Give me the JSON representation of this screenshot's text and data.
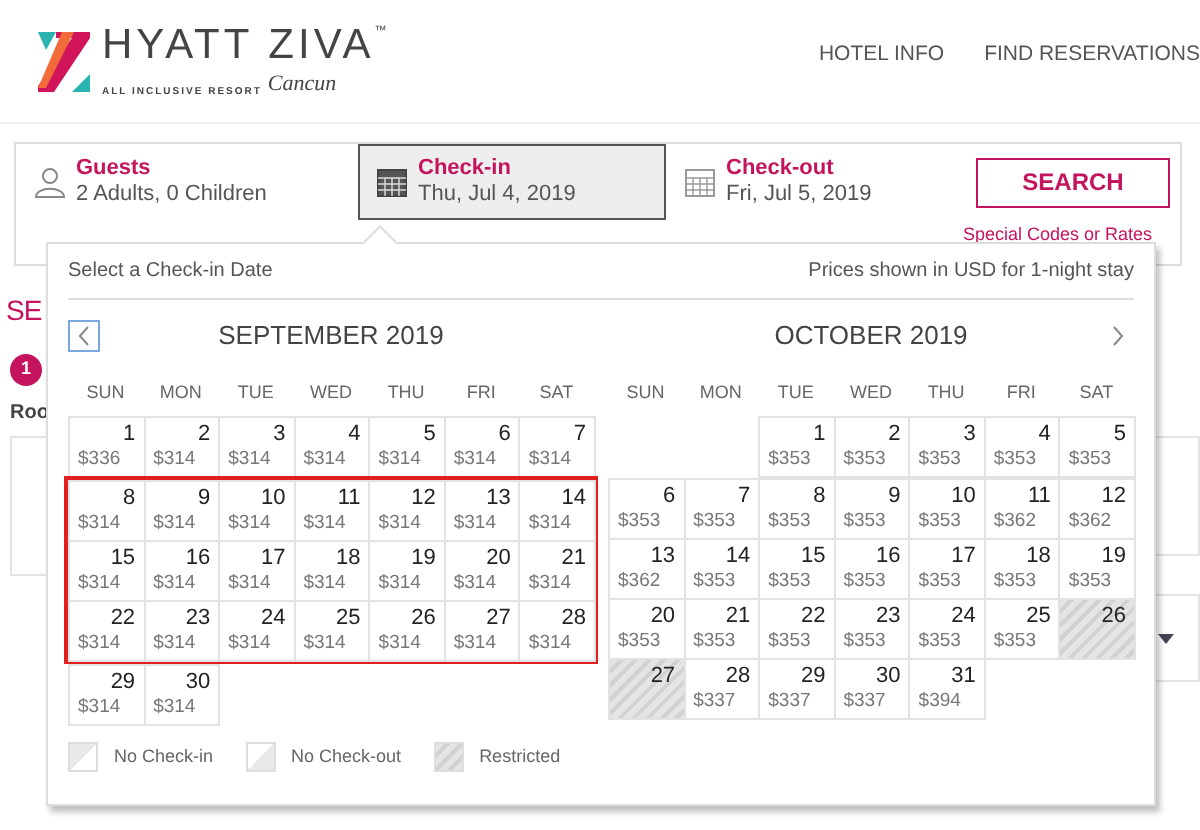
{
  "logo": {
    "name": "HYATT ZIVA",
    "trademark": "™",
    "tagline": "ALL INCLUSIVE RESORT",
    "location": "Cancun"
  },
  "nav": [
    "HOTEL INFO",
    "FIND RESERVATIONS"
  ],
  "search_bar": {
    "fields": [
      {
        "kind": "guests",
        "label": "Guests",
        "value": "2 Adults, 0 Children",
        "selected": false
      },
      {
        "kind": "calendar",
        "label": "Check-in",
        "value": "Thu, Jul 4, 2019",
        "selected": true
      },
      {
        "kind": "calendar",
        "label": "Check-out",
        "value": "Fri, Jul 5, 2019",
        "selected": false
      }
    ],
    "button": "SEARCH",
    "link": "Special Codes or Rates"
  },
  "background": {
    "heading": "SE",
    "step": "1",
    "subheading": "Roo"
  },
  "date_picker": {
    "title": "Select a Check-in Date",
    "note": "Prices shown in USD for 1-night stay",
    "months": [
      {
        "title": "SEPTEMBER 2019",
        "prev_arrow": true,
        "next_arrow": false,
        "weekdays": [
          "SUN",
          "MON",
          "TUE",
          "WED",
          "THU",
          "FRI",
          "SAT"
        ],
        "weeks": [
          {
            "highlighted": false,
            "days": [
              {
                "day": "1",
                "price": "$336",
                "kind": "open"
              },
              {
                "day": "2",
                "price": "$314",
                "kind": "open"
              },
              {
                "day": "3",
                "price": "$314",
                "kind": "open"
              },
              {
                "day": "4",
                "price": "$314",
                "kind": "open"
              },
              {
                "day": "5",
                "price": "$314",
                "kind": "open"
              },
              {
                "day": "6",
                "price": "$314",
                "kind": "open"
              },
              {
                "day": "7",
                "price": "$314",
                "kind": "open"
              }
            ]
          },
          {
            "highlighted": true,
            "days": [
              {
                "day": "8",
                "price": "$314",
                "kind": "open"
              },
              {
                "day": "9",
                "price": "$314",
                "kind": "open"
              },
              {
                "day": "10",
                "price": "$314",
                "kind": "open"
              },
              {
                "day": "11",
                "price": "$314",
                "kind": "open"
              },
              {
                "day": "12",
                "price": "$314",
                "kind": "open"
              },
              {
                "day": "13",
                "price": "$314",
                "kind": "open"
              },
              {
                "day": "14",
                "price": "$314",
                "kind": "open"
              }
            ]
          },
          {
            "highlighted": true,
            "days": [
              {
                "day": "15",
                "price": "$314",
                "kind": "open"
              },
              {
                "day": "16",
                "price": "$314",
                "kind": "open"
              },
              {
                "day": "17",
                "price": "$314",
                "kind": "open"
              },
              {
                "day": "18",
                "price": "$314",
                "kind": "open"
              },
              {
                "day": "19",
                "price": "$314",
                "kind": "open"
              },
              {
                "day": "20",
                "price": "$314",
                "kind": "open"
              },
              {
                "day": "21",
                "price": "$314",
                "kind": "open"
              }
            ]
          },
          {
            "highlighted": true,
            "days": [
              {
                "day": "22",
                "price": "$314",
                "kind": "open"
              },
              {
                "day": "23",
                "price": "$314",
                "kind": "open"
              },
              {
                "day": "24",
                "price": "$314",
                "kind": "open"
              },
              {
                "day": "25",
                "price": "$314",
                "kind": "open"
              },
              {
                "day": "26",
                "price": "$314",
                "kind": "open"
              },
              {
                "day": "27",
                "price": "$314",
                "kind": "open"
              },
              {
                "day": "28",
                "price": "$314",
                "kind": "open"
              }
            ]
          },
          {
            "highlighted": false,
            "days": [
              {
                "day": "29",
                "price": "$314",
                "kind": "open"
              },
              {
                "day": "30",
                "price": "$314",
                "kind": "open"
              },
              {
                "kind": "empty"
              },
              {
                "kind": "empty"
              },
              {
                "kind": "empty"
              },
              {
                "kind": "empty"
              },
              {
                "kind": "empty"
              }
            ]
          }
        ]
      },
      {
        "title": "OCTOBER 2019",
        "prev_arrow": false,
        "next_arrow": true,
        "weekdays": [
          "SUN",
          "MON",
          "TUE",
          "WED",
          "THU",
          "FRI",
          "SAT"
        ],
        "weeks": [
          {
            "highlighted": false,
            "days": [
              {
                "kind": "empty"
              },
              {
                "kind": "empty"
              },
              {
                "day": "1",
                "price": "$353",
                "kind": "open"
              },
              {
                "day": "2",
                "price": "$353",
                "kind": "open"
              },
              {
                "day": "3",
                "price": "$353",
                "kind": "open"
              },
              {
                "day": "4",
                "price": "$353",
                "kind": "open"
              },
              {
                "day": "5",
                "price": "$353",
                "kind": "open"
              }
            ]
          },
          {
            "highlighted": false,
            "days": [
              {
                "day": "6",
                "price": "$353",
                "kind": "open"
              },
              {
                "day": "7",
                "price": "$353",
                "kind": "open"
              },
              {
                "day": "8",
                "price": "$353",
                "kind": "open"
              },
              {
                "day": "9",
                "price": "$353",
                "kind": "open"
              },
              {
                "day": "10",
                "price": "$353",
                "kind": "open"
              },
              {
                "day": "11",
                "price": "$362",
                "kind": "open"
              },
              {
                "day": "12",
                "price": "$362",
                "kind": "open"
              }
            ]
          },
          {
            "highlighted": false,
            "days": [
              {
                "day": "13",
                "price": "$362",
                "kind": "open"
              },
              {
                "day": "14",
                "price": "$353",
                "kind": "open"
              },
              {
                "day": "15",
                "price": "$353",
                "kind": "open"
              },
              {
                "day": "16",
                "price": "$353",
                "kind": "open"
              },
              {
                "day": "17",
                "price": "$353",
                "kind": "open"
              },
              {
                "day": "18",
                "price": "$353",
                "kind": "open"
              },
              {
                "day": "19",
                "price": "$353",
                "kind": "open"
              }
            ]
          },
          {
            "highlighted": false,
            "days": [
              {
                "day": "20",
                "price": "$353",
                "kind": "open"
              },
              {
                "day": "21",
                "price": "$353",
                "kind": "open"
              },
              {
                "day": "22",
                "price": "$353",
                "kind": "open"
              },
              {
                "day": "23",
                "price": "$353",
                "kind": "open"
              },
              {
                "day": "24",
                "price": "$353",
                "kind": "open"
              },
              {
                "day": "25",
                "price": "$353",
                "kind": "open"
              },
              {
                "day": "26",
                "kind": "restricted"
              }
            ]
          },
          {
            "highlighted": false,
            "days": [
              {
                "day": "27",
                "kind": "restricted"
              },
              {
                "day": "28",
                "price": "$337",
                "kind": "open"
              },
              {
                "day": "29",
                "price": "$337",
                "kind": "open"
              },
              {
                "day": "30",
                "price": "$337",
                "kind": "open"
              },
              {
                "day": "31",
                "price": "$394",
                "kind": "open"
              },
              {
                "kind": "empty"
              },
              {
                "kind": "empty"
              }
            ]
          }
        ]
      }
    ],
    "legend": [
      {
        "kind": "no-checkin",
        "label": "No Check-in"
      },
      {
        "kind": "no-checkout",
        "label": "No Check-out"
      },
      {
        "kind": "restricted",
        "label": "Restricted"
      }
    ]
  }
}
